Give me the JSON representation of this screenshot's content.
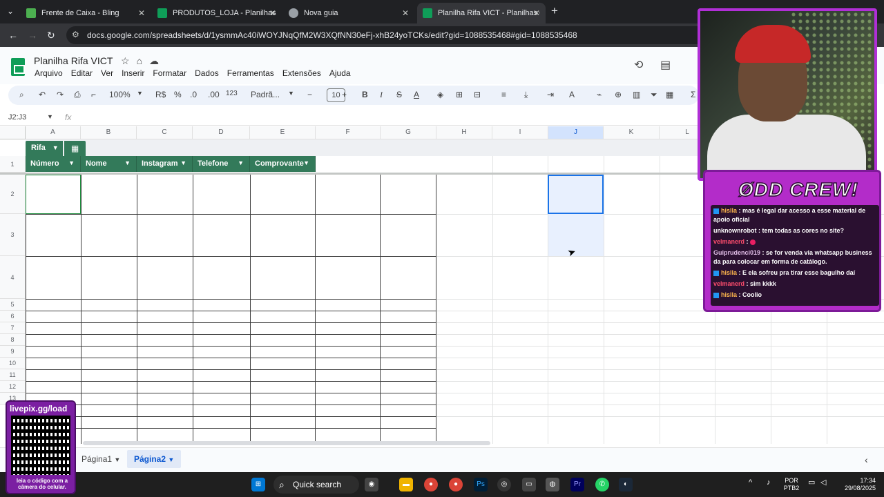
{
  "browser": {
    "tabs": [
      {
        "title": "Frente de Caixa - Bling",
        "color": "#4caf50"
      },
      {
        "title": "PRODUTOS_LOJA - Planilhas Google",
        "color": "#0f9d58"
      },
      {
        "title": "Nova guia",
        "color": "#9aa0a6"
      },
      {
        "title": "Planilha Rifa VICT - Planilhas Google",
        "color": "#0f9d58"
      }
    ],
    "url": "docs.google.com/spreadsheets/d/1ysmmAc40iWOYJNqQfM2W3XQfNN30eFj-xhB24yoTCKs/edit?gid=1088535468#gid=1088535468"
  },
  "sheets": {
    "title": "Planilha Rifa VICT",
    "menu": [
      "Arquivo",
      "Editar",
      "Ver",
      "Inserir",
      "Formatar",
      "Dados",
      "Ferramentas",
      "Extensões",
      "Ajuda"
    ],
    "toolbar": {
      "zoom": "100%",
      "currency": "R$",
      "percent": "%",
      "dec_less": ".0",
      "dec_more": ".00",
      "number_format": "123",
      "font": "Padrã...",
      "font_size": "10"
    },
    "name_box": "J2:J3",
    "fx": "fx",
    "columns": [
      "A",
      "B",
      "C",
      "D",
      "E",
      "F",
      "G",
      "H",
      "I",
      "J",
      "K",
      "L"
    ],
    "rows": [
      "1",
      "2",
      "3",
      "4",
      "5",
      "6",
      "7",
      "8",
      "9",
      "10",
      "11",
      "12",
      "13"
    ],
    "table": {
      "name": "Rifa",
      "headers": [
        "Número",
        "Nome",
        "Instagram",
        "Telefone",
        "Comprovante"
      ]
    },
    "sheet_tabs": [
      "Página1",
      "Página2"
    ]
  },
  "taskbar": {
    "search": "Quick search",
    "lang": "POR",
    "layout": "PTB2",
    "time": "17:34",
    "date": "29/08/2025"
  },
  "chat": {
    "title": "ØDD CREW!",
    "messages": [
      {
        "user": "hislla",
        "text": "mas é legal dar acesso a esse material de apoio oficial"
      },
      {
        "user": "unknownrobot",
        "text": "tem todas as cores no site?"
      },
      {
        "user": "velmanerd",
        "text": ""
      },
      {
        "user": "Guiprudenci019",
        "text": "se for venda via whatsapp business da para colocar em forma de catálogo."
      },
      {
        "user": "hislla",
        "text": "E ela sofreu pra tirar esse bagulho daí"
      },
      {
        "user": "velmanerd",
        "text": "sim kkkk"
      },
      {
        "user": "hislla",
        "text": "Coolio"
      }
    ]
  },
  "qr": {
    "title": "livepix.gg/load",
    "footer": "leia o código com a câmera do celular."
  }
}
